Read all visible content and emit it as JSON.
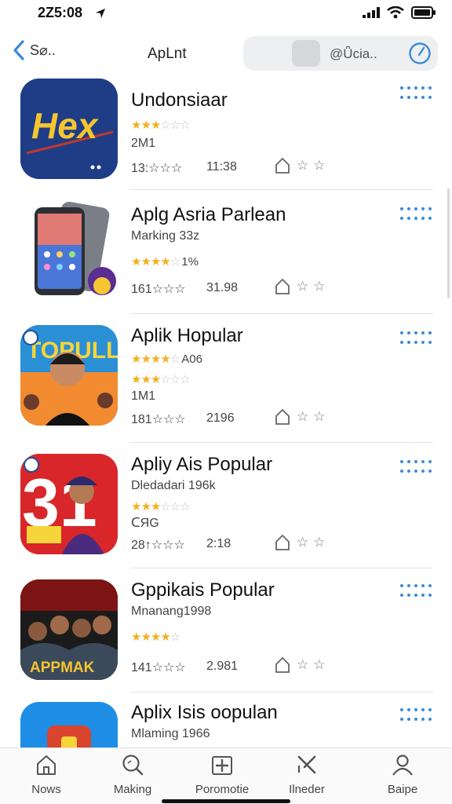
{
  "status_bar": {
    "time": "2Z5:08"
  },
  "nav": {
    "back_label": "S⌀..",
    "title": "ApLnt",
    "search_text": "@Ǖcia.."
  },
  "apps": [
    {
      "title": "Undonsiaar",
      "icon_text": "Hex",
      "rating_value": 3,
      "line1": "2M1",
      "stat_a": "13:☆☆☆",
      "stat_b": "11:38"
    },
    {
      "title": "Aplg Asria Parlean",
      "subtitle": "Marking 33z",
      "rating_value": 4,
      "rating_text": "1%",
      "stat_a": "161☆☆☆",
      "stat_b": "31.98"
    },
    {
      "title": "Aplik Hopular",
      "icon_text": "TOPULL",
      "rating_value": 4,
      "rating_text": "A06",
      "rating2_value": 3,
      "line1": "1M1",
      "stat_a": "181☆☆☆",
      "stat_b": "2196"
    },
    {
      "title": "Apliy Ais Popular",
      "icon_text": "31",
      "subtitle": "Dledadari 196k",
      "rating_value": 3,
      "line1": "ᑕЯG",
      "stat_a": "28↑☆☆☆",
      "stat_b": "2:18"
    },
    {
      "title": "Gppikais Popular",
      "icon_text": "APPMAK",
      "subtitle": "Mnanang1998",
      "rating_value": 4,
      "stat_a": "141☆☆☆",
      "stat_b": "2.981"
    },
    {
      "title": "Aplix Isis oopulan",
      "subtitle": "Mlaming 1966"
    }
  ],
  "tabs": [
    {
      "label": "Nows",
      "icon": "home-icon"
    },
    {
      "label": "Making",
      "icon": "search-icon"
    },
    {
      "label": "Poromotie",
      "icon": "add-square-icon"
    },
    {
      "label": "Ilneder",
      "icon": "tools-icon"
    },
    {
      "label": "Baipe",
      "icon": "person-icon"
    }
  ],
  "colors": {
    "accent": "#3d8ad8",
    "star": "#f2b01e",
    "separator": "#e3e3e6"
  }
}
